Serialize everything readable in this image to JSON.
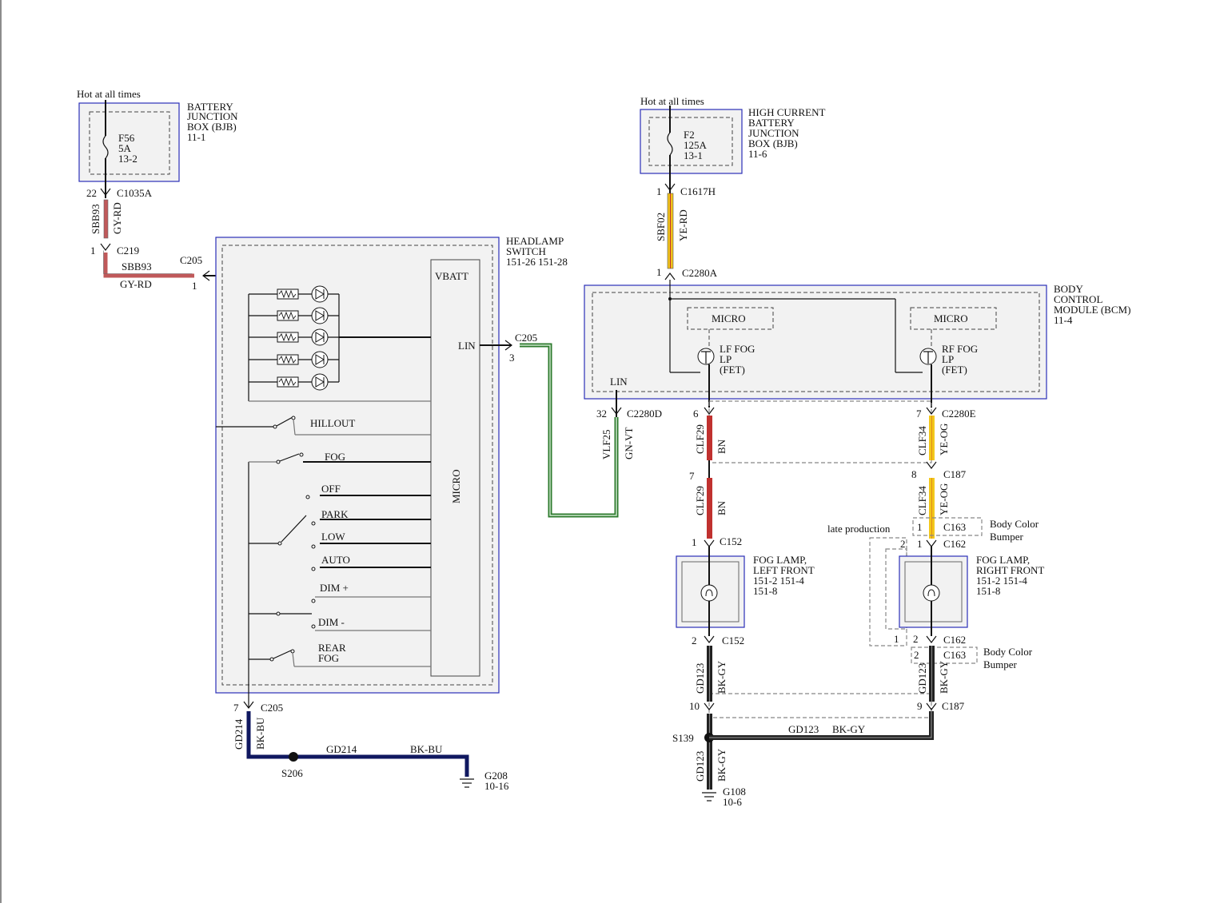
{
  "left_bjb": {
    "hot_label": "Hot at all times",
    "title": [
      "BATTERY",
      "JUNCTION",
      "BOX (BJB)",
      "11-1"
    ],
    "fuse": [
      "F56",
      "5A",
      "13-2"
    ],
    "pin_top": "22",
    "connector_top": "C1035A",
    "circuit_vertical": "SBB93",
    "color_vertical": "GY-RD",
    "pin_c219": "1",
    "connector_c219": "C219",
    "circuit_horizontal": "SBB93",
    "color_horizontal": "GY-RD",
    "connector_c205": "C205",
    "pin_c205": "1"
  },
  "headlamp_switch": {
    "title": [
      "HEADLAMP",
      "SWITCH",
      "151-26   151-28"
    ],
    "vbatt": "VBATT",
    "lin": "LIN",
    "micro": "MICRO",
    "positions": [
      "HILLOUT",
      "FOG",
      "OFF",
      "PARK",
      "LOW",
      "AUTO",
      "DIM +",
      "DIM -",
      "REAR",
      "FOG"
    ],
    "lin_connector": "C205",
    "lin_pin": "3",
    "ground_pin": "7",
    "ground_connector": "C205",
    "ground_circuit_v": "GD214",
    "ground_color_v": "BK-BU",
    "ground_circuit_h": "GD214",
    "ground_color_h": "BK-BU",
    "splice": "S206",
    "ground_point": [
      "G208",
      "10-16"
    ]
  },
  "right_bjb": {
    "hot_label": "Hot at all times",
    "title": [
      "HIGH CURRENT",
      "BATTERY",
      "JUNCTION",
      "BOX (BJB)",
      "11-6"
    ],
    "fuse": [
      "F2",
      "125A",
      "13-1"
    ],
    "pin_top": "1",
    "connector_top": "C1617H",
    "circuit": "SBF02",
    "color": "YE-RD",
    "pin_bottom": "1",
    "connector_bottom": "C2280A"
  },
  "bcm": {
    "title": [
      "BODY",
      "CONTROL",
      "MODULE (BCM)",
      "11-4"
    ],
    "micro_left": "MICRO",
    "micro_right": "MICRO",
    "lf_fet": [
      "LF FOG",
      "LP",
      "(FET)"
    ],
    "rf_fet": [
      "RF FOG",
      "LP",
      "(FET)"
    ],
    "lin": "LIN",
    "lin_pin": "32",
    "lin_connector": "C2280D",
    "lin_circuit": "VLF25",
    "lin_color": "GN-VT"
  },
  "left_fog": {
    "pin_bcm": "6",
    "connector_bcm": "C2280E",
    "circuit_a": "CLF29",
    "color_a": "BN",
    "pin_mid": "7",
    "circuit_b": "CLF29",
    "color_b": "BN",
    "pin_lamp": "1",
    "connector_lamp": "C152",
    "title": [
      "FOG LAMP,",
      "LEFT FRONT",
      "151-2   151-4",
      "151-8"
    ],
    "pin_lamp_out": "2",
    "connector_lamp_out": "C152",
    "circuit_gnd": "GD123",
    "color_gnd": "BK-GY",
    "pin_splice": "10",
    "splice": "S139",
    "circuit_gnd2": "GD123",
    "color_gnd2": "BK-GY",
    "ground_point": [
      "G108",
      "10-6"
    ]
  },
  "right_fog": {
    "pin_bcm": "7",
    "connector_bcm": "C2280E",
    "circuit_a": "CLF34",
    "color_a": "YE-OG",
    "pin_mid": "8",
    "connector_mid": "C187",
    "circuit_b": "CLF34",
    "color_b": "YE-OG",
    "late_production": "late production",
    "c163_pin_top": "1",
    "c163_top": "C163",
    "body_color_top": [
      "Body Color",
      "Bumper"
    ],
    "pin_2_dashed": "2",
    "pin_lamp": "1",
    "connector_lamp": "C162",
    "title": [
      "FOG LAMP,",
      "RIGHT FRONT",
      "151-2   151-4",
      "151-8"
    ],
    "pin_1_dashed": "1",
    "pin_lamp_out": "2",
    "connector_lamp_out": "C162",
    "c163_pin_bottom": "2",
    "c163_bottom": "C163",
    "body_color_bottom": [
      "Body Color",
      "Bumper"
    ],
    "circuit_gnd": "GD123",
    "color_gnd": "BK-GY",
    "pin_c187": "9",
    "connector_c187": "C187",
    "circuit_h": "GD123",
    "color_h": "BK-GY"
  },
  "colors": {
    "box_border": "#2b2fb8",
    "gy_rd": "#c0595a",
    "ye_rd": "#f0c21a",
    "gn_vt": "#2d7a2d",
    "bn": "#c0312f",
    "ye_og": "#f3c81b",
    "bk_bu": "#101860",
    "bk_gy": "#222222"
  }
}
